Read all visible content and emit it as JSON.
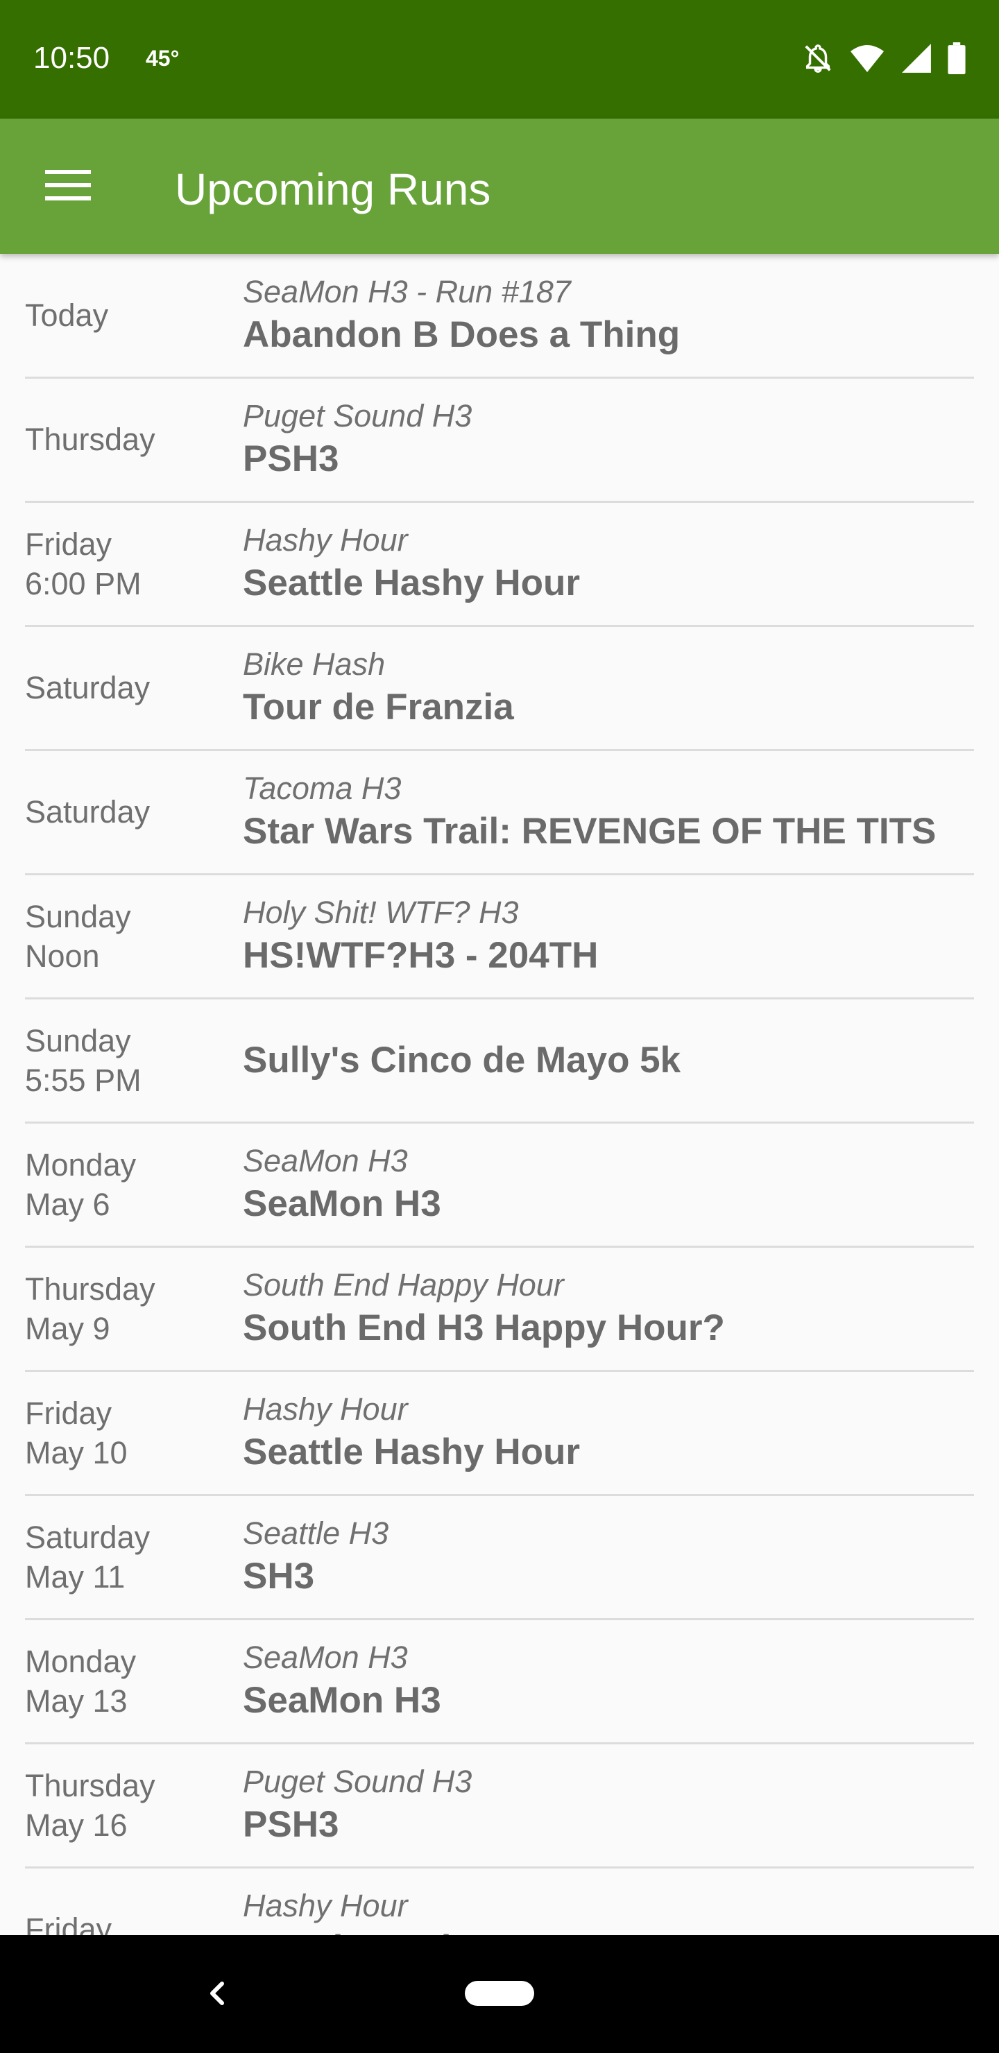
{
  "status_bar": {
    "time": "10:50",
    "temperature": "45°",
    "icons": [
      "notifications-off-icon",
      "wifi-icon",
      "signal-icon",
      "battery-icon"
    ]
  },
  "app_bar": {
    "title": "Upcoming Runs",
    "menu_icon": "hamburger-menu-icon"
  },
  "runs": [
    {
      "day": "Today",
      "detail": "",
      "kennel": "SeaMon H3  - Run #187",
      "name": "Abandon B Does a Thing"
    },
    {
      "day": "Thursday",
      "detail": "",
      "kennel": "Puget Sound H3",
      "name": "PSH3"
    },
    {
      "day": "Friday",
      "detail": "6:00 PM",
      "kennel": "Hashy Hour",
      "name": "Seattle Hashy Hour"
    },
    {
      "day": "Saturday",
      "detail": "",
      "kennel": "Bike Hash",
      "name": "Tour de Franzia"
    },
    {
      "day": "Saturday",
      "detail": "",
      "kennel": "Tacoma H3",
      "name": "Star Wars Trail: REVENGE OF THE TITS"
    },
    {
      "day": "Sunday",
      "detail": "Noon",
      "kennel": "Holy Shit! WTF? H3",
      "name": "HS!WTF?H3 - 204TH"
    },
    {
      "day": "Sunday",
      "detail": "5:55 PM",
      "kennel": "",
      "name": "Sully's Cinco de Mayo 5k"
    },
    {
      "day": "Monday",
      "detail": "May 6",
      "kennel": "SeaMon H3",
      "name": "SeaMon H3"
    },
    {
      "day": "Thursday",
      "detail": "May 9",
      "kennel": "South End Happy Hour",
      "name": "South End H3 Happy Hour?"
    },
    {
      "day": "Friday",
      "detail": "May 10",
      "kennel": "Hashy Hour",
      "name": "Seattle Hashy Hour"
    },
    {
      "day": "Saturday",
      "detail": "May 11",
      "kennel": "Seattle H3",
      "name": "SH3"
    },
    {
      "day": "Monday",
      "detail": "May 13",
      "kennel": "SeaMon H3",
      "name": "SeaMon H3"
    },
    {
      "day": "Thursday",
      "detail": "May 16",
      "kennel": "Puget Sound H3",
      "name": "PSH3"
    },
    {
      "day": "Friday",
      "detail": "",
      "kennel": "Hashy Hour",
      "name": "Seattle Hashy Hour"
    }
  ],
  "nav_bar": {
    "back_icon": "back-chevron-icon",
    "home_icon": "home-pill-icon"
  },
  "colors": {
    "status_bar": "#356f00",
    "app_bar": "#68a33a",
    "background": "#fafafa",
    "divider": "#dcdcdc",
    "text": "#6a6a6a"
  }
}
